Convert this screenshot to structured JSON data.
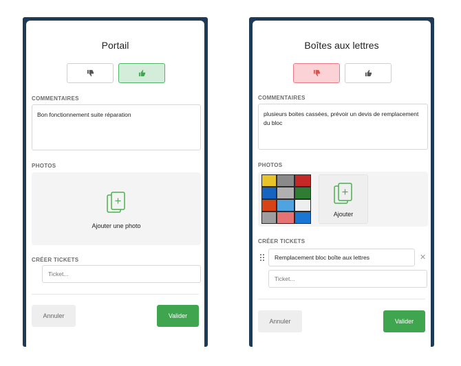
{
  "left": {
    "title": "Portail",
    "comments_label": "COMMENTAIRES",
    "comment_text": "Bon fonctionnement suite réparation",
    "photos_label": "PHOTOS",
    "add_photo_label": "Ajouter une photo",
    "tickets_label": "CRÉER TICKETS",
    "ticket_placeholder": "Ticket...",
    "cancel_label": "Annuler",
    "submit_label": "Valider",
    "vote_selected": "up"
  },
  "right": {
    "title": "Boîtes aux lettres",
    "comments_label": "COMMENTAIRES",
    "comment_text": "plusieurs boites cassées, prévoir un devis de remplacement du bloc",
    "photos_label": "PHOTOS",
    "add_photo_label": "Ajouter",
    "tickets_label": "CRÉER TICKETS",
    "ticket_item": "Remplacement bloc boîte aux lettres",
    "ticket_placeholder": "Ticket...",
    "cancel_label": "Annuler",
    "submit_label": "Valider",
    "vote_selected": "down"
  },
  "colors": {
    "frame": "#1f3a55",
    "accent_green": "#3fa64f",
    "up_active_bg": "#d4edda",
    "down_active_bg": "#fbd3d6",
    "icon_green": "#4caf50"
  },
  "icons": [
    "thumbs-down-icon",
    "thumbs-up-icon",
    "add-photo-icon",
    "drag-handle-icon",
    "close-icon"
  ]
}
